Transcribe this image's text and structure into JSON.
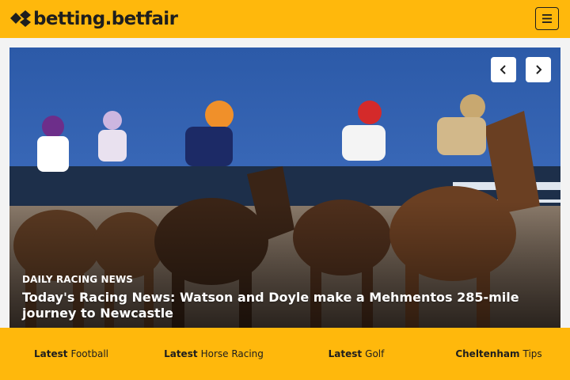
{
  "brand": {
    "logo_text": "betting.betfair",
    "accent_color": "#ffb80c",
    "text_color": "#1e1e1e"
  },
  "header": {
    "menu_icon": "hamburger-menu-icon"
  },
  "hero": {
    "image_subject": "horses racing on an all-weather track at dusk",
    "prev_icon": "chevron-left-icon",
    "next_icon": "chevron-right-icon",
    "category": "DAILY RACING NEWS",
    "headline": "Today's Racing News: Watson and Doyle make a Mehmentos 285-mile journey to Newcastle"
  },
  "bottom_nav": {
    "items": [
      {
        "bold": "Latest",
        "label": "Football"
      },
      {
        "bold": "Latest",
        "label": "Horse Racing"
      },
      {
        "bold": "Latest",
        "label": "Golf"
      },
      {
        "bold": "Cheltenham",
        "label": "Tips"
      }
    ]
  }
}
